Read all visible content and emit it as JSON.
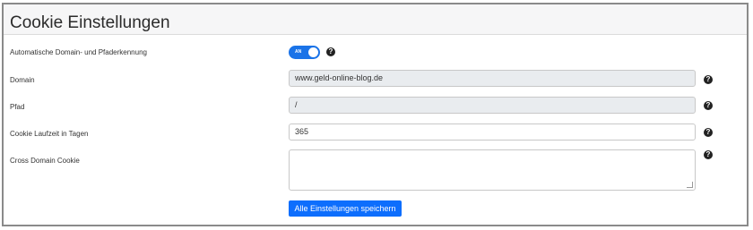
{
  "section": {
    "title": "Cookie Einstellungen"
  },
  "settings": [
    {
      "label": "Automatische Domain- und Pfaderkennung",
      "type": "toggle",
      "toggle_text": "AN",
      "on": true
    },
    {
      "label": "Domain",
      "type": "readonly",
      "value": "www.geld-online-blog.de"
    },
    {
      "label": "Pfad",
      "type": "readonly",
      "value": "/"
    },
    {
      "label": "Cookie Laufzeit in Tagen",
      "type": "text",
      "value": "365"
    },
    {
      "label": "Cross Domain Cookie",
      "type": "textarea",
      "value": ""
    }
  ],
  "save_button": {
    "label": "Alle Einstellungen speichern"
  },
  "help_icon": {
    "glyph": "?"
  },
  "colors": {
    "accent": "#0d6efd",
    "toggle_on": "#1a73e8",
    "readonly_bg": "#e9ecef",
    "header_bg": "#f6f6f7"
  }
}
